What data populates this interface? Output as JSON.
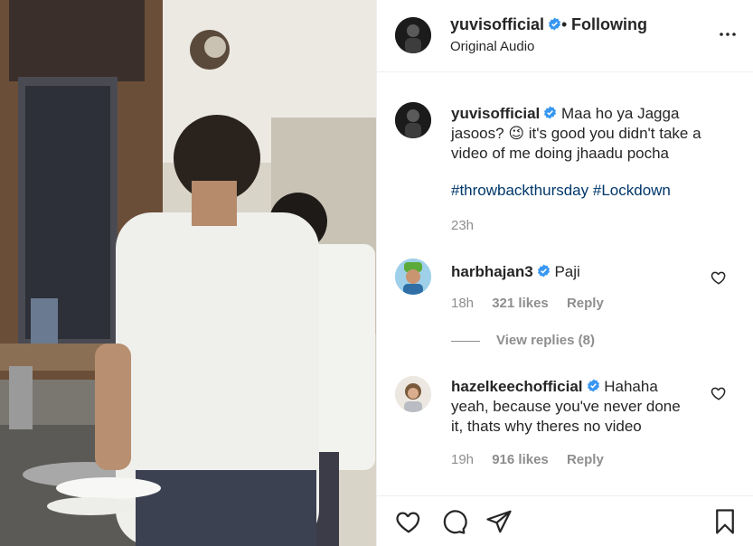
{
  "post": {
    "username": "yuvisofficial",
    "follow_dot": "•",
    "follow_status": "Following",
    "audio": "Original Audio"
  },
  "caption": {
    "username": "yuvisofficial",
    "text": "Maa ho ya Jagga jasoos? 😉 it's good you didn't take a video of me doing jhaadu pocha",
    "hashtags": [
      "#throwbackthursday",
      "#Lockdown"
    ],
    "time": "23h"
  },
  "comments": [
    {
      "username": "harbhajan3",
      "text": "Paji",
      "time": "18h",
      "likes": "321 likes",
      "reply": "Reply",
      "view_replies": "View replies (8)"
    },
    {
      "username": "hazelkeechofficial",
      "text": "Hahaha yeah, because you've never done it, thats why theres no video",
      "time": "19h",
      "likes": "916 likes",
      "reply": "Reply"
    }
  ],
  "icons": {
    "verified": "verified-badge-icon",
    "more": "more-options-icon",
    "like": "heart-icon",
    "comment": "comment-icon",
    "share": "paper-plane-icon",
    "save": "bookmark-icon"
  },
  "colors": {
    "text": "#262626",
    "secondary": "#8e8e8e",
    "hashtag": "#00376b",
    "verified": "#3897f0",
    "divider": "#efefef"
  }
}
